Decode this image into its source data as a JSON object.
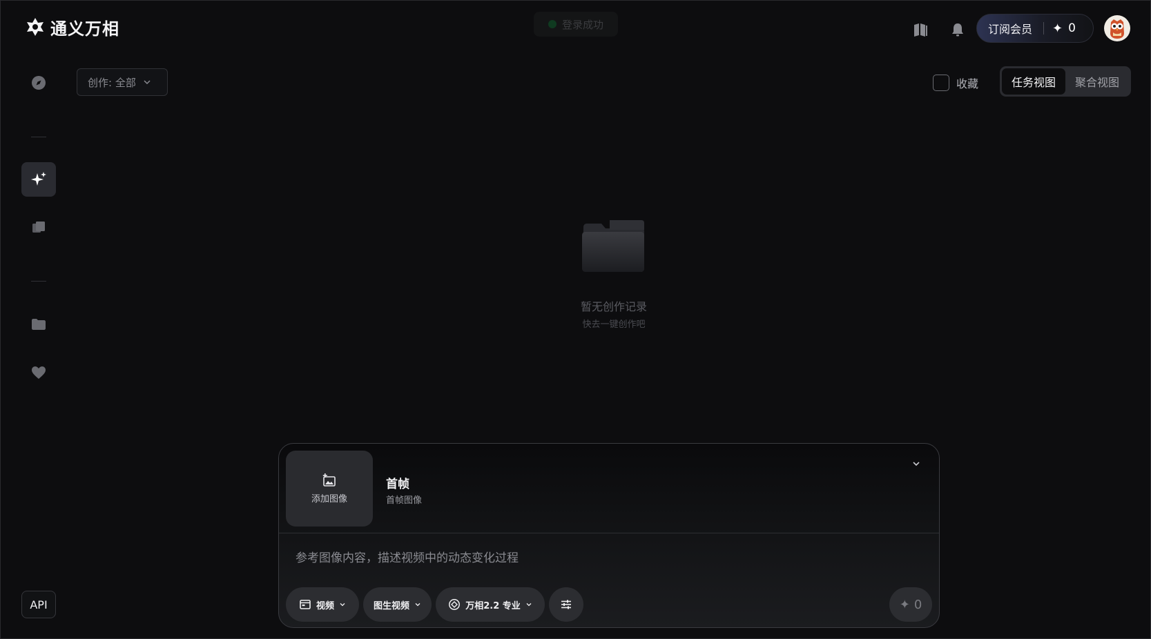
{
  "app": {
    "name": "通义万相"
  },
  "toast": {
    "message": "登录成功"
  },
  "header": {
    "vip_label": "订阅会员",
    "credits": "0"
  },
  "sidebar": {
    "items": [
      {
        "id": "explore",
        "icon": "compass-icon"
      },
      {
        "id": "create",
        "icon": "sparkle-icon",
        "active": true
      },
      {
        "id": "gallery",
        "icon": "layers-icon"
      },
      {
        "id": "assets",
        "icon": "folder-icon"
      },
      {
        "id": "favorites",
        "icon": "heart-icon"
      }
    ],
    "api_label": "API"
  },
  "toolbar": {
    "filter_label": "创作: 全部",
    "favorite_label": "收藏",
    "views": [
      "任务视图",
      "聚合视图"
    ],
    "active_view": "任务视图"
  },
  "empty_state": {
    "title": "暂无创作记录",
    "subtitle": "快去一键创作吧"
  },
  "composer": {
    "add_image_label": "添加图像",
    "frame_title": "首帧",
    "frame_subtitle": "首帧图像",
    "prompt_placeholder": "参考图像内容，描述视频中的动态变化过程",
    "mode_label": "视频",
    "type_label": "图生视频",
    "model_label": "万相2.2 专业",
    "send_cost": "0"
  },
  "colors": {
    "background": "#0d0d0f",
    "active_item": "#2a2b31",
    "pill": "#2c2d31"
  }
}
